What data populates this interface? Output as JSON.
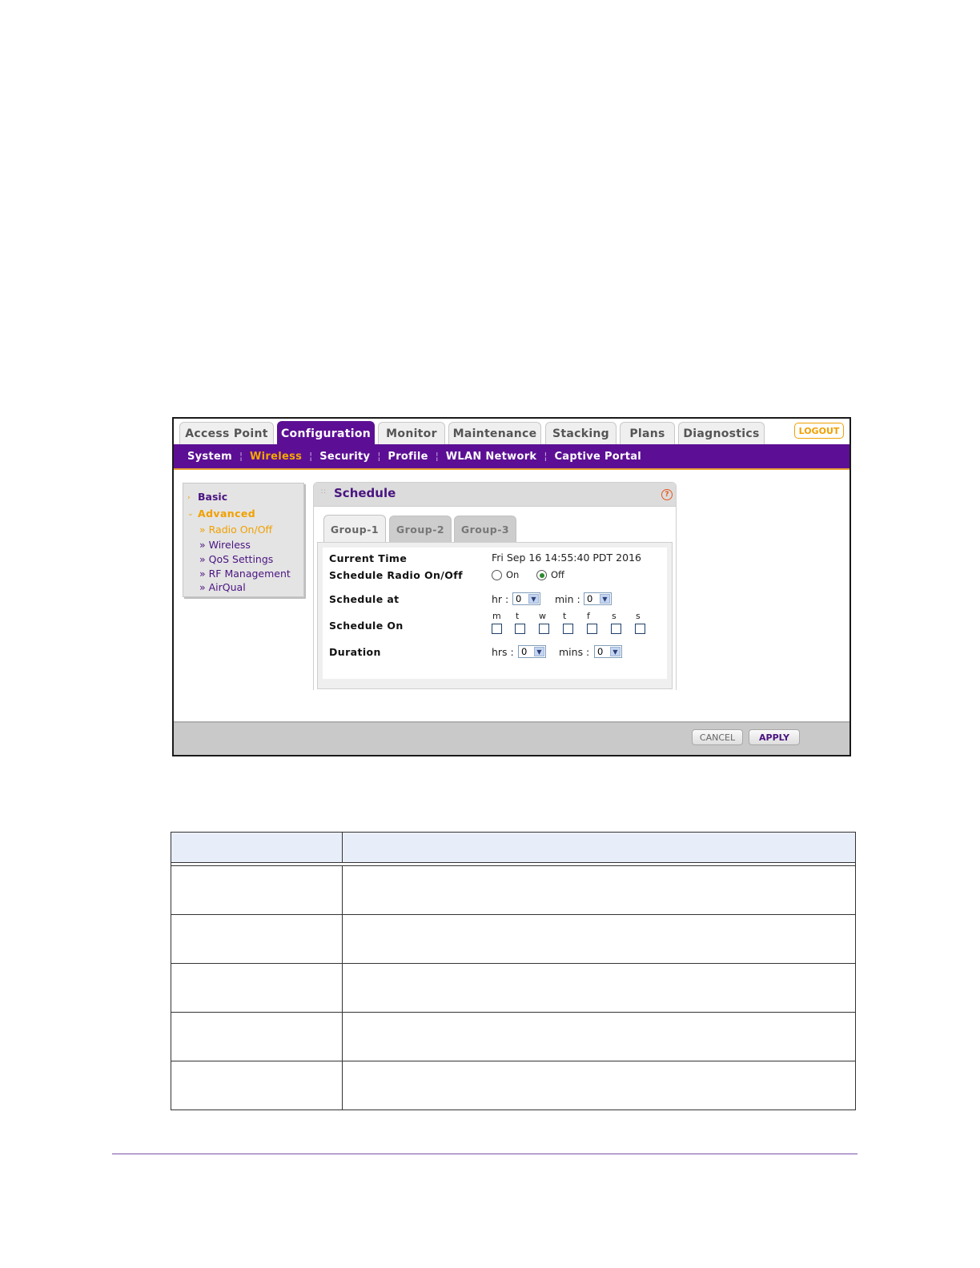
{
  "top_tabs": [
    "Access Point",
    "Configuration",
    "Monitor",
    "Maintenance",
    "Stacking",
    "Plans",
    "Diagnostics"
  ],
  "active_top_tab": "Configuration",
  "logout_label": "LOGOUT",
  "sub_nav": [
    "System",
    "Wireless",
    "Security",
    "Profile",
    "WLAN Network",
    "Captive Portal"
  ],
  "active_sub_nav": "Wireless",
  "left_menu": {
    "basic": "Basic",
    "advanced": "Advanced",
    "items": [
      "» Radio On/Off",
      "» Wireless",
      "» QoS Settings",
      "» RF Management",
      "» AirQual"
    ]
  },
  "panel": {
    "title": "Schedule",
    "help_icon": "?",
    "group_tabs": [
      "Group-1",
      "Group-2",
      "Group-3"
    ],
    "current_time_label": "Current Time",
    "current_time_value": "Fri Sep 16 14:55:40 PDT 2016",
    "radio_label": "Schedule Radio On/Off",
    "radio_on": "On",
    "radio_off": "Off",
    "radio_selected": "Off",
    "schedule_at_label": "Schedule at",
    "hr_label": "hr :",
    "hr_value": "0",
    "min_label": "min :",
    "min_value": "0",
    "schedule_on_label": "Schedule On",
    "days": [
      "m",
      "t",
      "w",
      "t",
      "f",
      "s",
      "s"
    ],
    "duration_label": "Duration",
    "hrs_label": "hrs :",
    "hrs_value": "0",
    "mins_label": "mins :",
    "mins_value": "0"
  },
  "buttons": {
    "cancel": "CANCEL",
    "apply": "APPLY"
  },
  "colors": {
    "brand_purple": "#5c0f94",
    "accent_orange": "#f0a000"
  }
}
